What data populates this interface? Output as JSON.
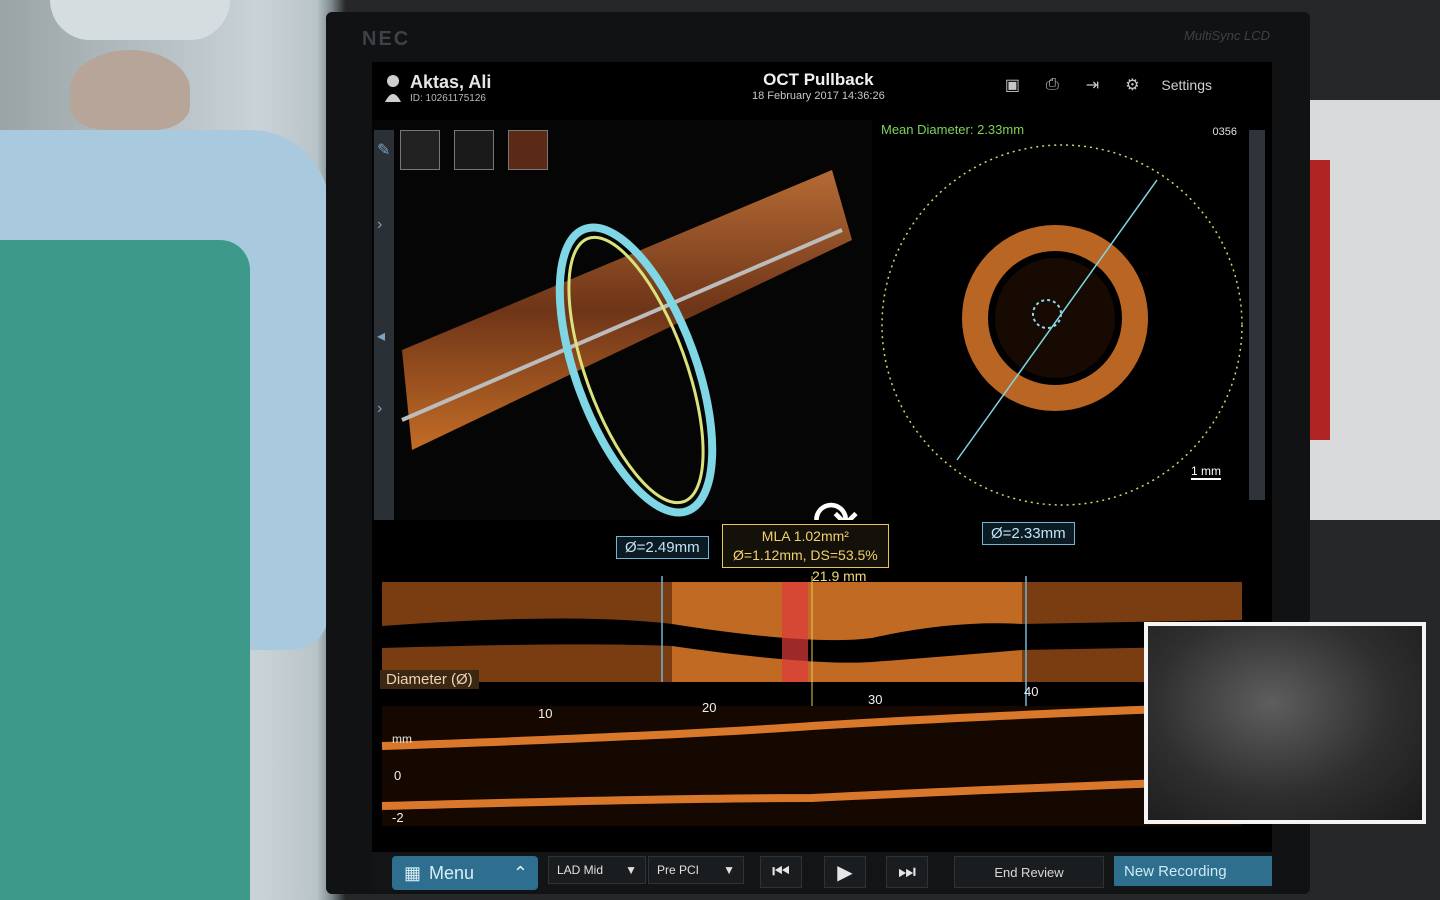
{
  "header": {
    "patient_name": "Aktas, Ali",
    "patient_id": "ID: 10261175126",
    "title": "OCT Pullback",
    "datetime": "18 February 2017 14:36:26",
    "settings_label": "Settings"
  },
  "monitor": {
    "brand": "NEC",
    "model": "MultiSync LCD"
  },
  "cross_section": {
    "mean_diameter": "Mean Diameter: 2.33mm",
    "frame_number": "0356",
    "scale_bar": "1 mm"
  },
  "longitudinal": {
    "left_ref_diameter": "Ø=2.49mm",
    "right_ref_diameter": "Ø=2.33mm",
    "mla_line1": "MLA 1.02mm²",
    "mla_line2": "Ø=1.12mm, DS=53.5%",
    "length": "21.9 mm",
    "diameter_label": "Diameter (Ø)",
    "ticks": [
      "10",
      "20",
      "30",
      "40"
    ],
    "axis_unit": "mm",
    "axis_zero": "0",
    "axis_minus2": "-2"
  },
  "bottom_bar": {
    "menu_label": "Menu",
    "vessel_select": "LAD Mid",
    "stage_select": "Pre PCI",
    "end_review_label": "End Review",
    "new_recording_label": "New Recording"
  },
  "icons": [
    "user-icon",
    "camera-icon",
    "print-icon",
    "export-icon",
    "gear-icon",
    "rotate-icon",
    "play-icon",
    "step-back-icon",
    "step-forward-icon",
    "menu-grid-icon",
    "chevron-up-icon",
    "dropdown-arrow-icon",
    "close-icon"
  ],
  "colors": {
    "accent_blue": "#2e6f8f",
    "mean_diameter_green": "#7ed35a",
    "mla_yellow": "#f2d16a",
    "reference_cyan": "#6fb7d6",
    "tissue_orange": "#d9782a"
  }
}
